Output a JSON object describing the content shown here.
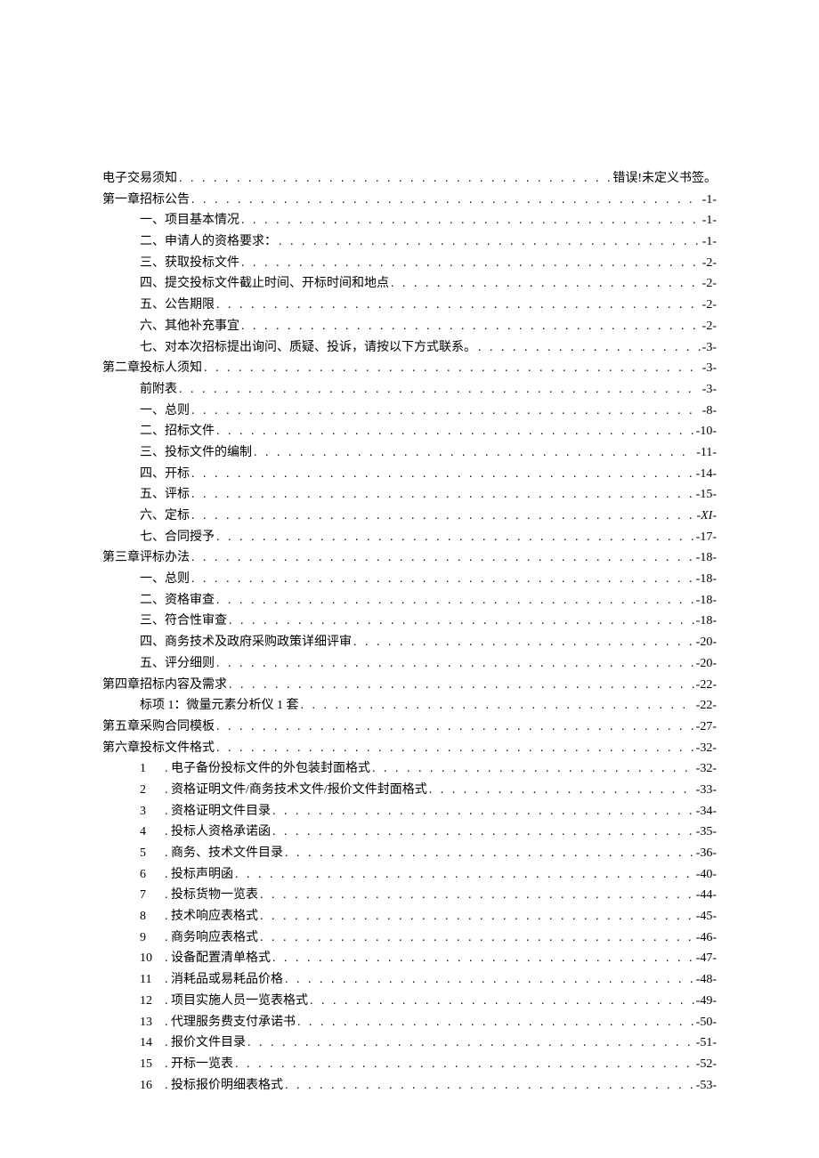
{
  "toc": [
    {
      "level": 0,
      "title": "电子交易须知",
      "page": "错误!未定义书签。"
    },
    {
      "level": 0,
      "title": "第一章招标公告",
      "page": "-1-"
    },
    {
      "level": 1,
      "title": "一、项目基本情况",
      "page": "-1-"
    },
    {
      "level": 1,
      "title": "二、申请人的资格要求：",
      "page": "-1-"
    },
    {
      "level": 1,
      "title": "三、获取投标文件",
      "page": "-2-"
    },
    {
      "level": 1,
      "title": "四、提交投标文件截止时间、开标时间和地点",
      "page": "-2-"
    },
    {
      "level": 1,
      "title": "五、公告期限",
      "page": "-2-"
    },
    {
      "level": 1,
      "title": "六、其他补充事宜",
      "page": "-2-"
    },
    {
      "level": 1,
      "title": "七、对本次招标提出询问、质疑、投诉，请按以下方式联系。",
      "page": "-3-"
    },
    {
      "level": 0,
      "title": "第二章投标人须知",
      "page": "-3-"
    },
    {
      "level": 1,
      "title": "前附表",
      "page": "-3-"
    },
    {
      "level": 1,
      "title": "一、总则",
      "page": "-8-"
    },
    {
      "level": 1,
      "title": "二、招标文件",
      "page": "-10-"
    },
    {
      "level": 1,
      "title": "三、投标文件的编制",
      "page": "-11-"
    },
    {
      "level": 1,
      "title": "四、开标",
      "page": "-14-"
    },
    {
      "level": 1,
      "title": "五、评标",
      "page": "-15-"
    },
    {
      "level": 1,
      "title": "六、定标",
      "page": "-XI-",
      "italic": true
    },
    {
      "level": 1,
      "title": "七、合同授予",
      "page": "-17-"
    },
    {
      "level": 0,
      "title": "第三章评标办法",
      "page": "-18-"
    },
    {
      "level": 1,
      "title": "一、总则",
      "page": "-18-"
    },
    {
      "level": 1,
      "title": "二、资格审查",
      "page": "-18-"
    },
    {
      "level": 1,
      "title": "三、符合性审查",
      "page": "-18-"
    },
    {
      "level": 1,
      "title": "四、商务技术及政府采购政策详细评审",
      "page": "-20-"
    },
    {
      "level": 1,
      "title": "五、评分细则",
      "page": "-20-"
    },
    {
      "level": 0,
      "title": "第四章招标内容及需求",
      "page": "-22-"
    },
    {
      "level": 1,
      "title": "标项 1：微量元素分析仪 1 套",
      "page": "-22-"
    },
    {
      "level": 0,
      "title": "第五章采购合同模板",
      "page": "-27-"
    },
    {
      "level": 0,
      "title": "第六章投标文件格式",
      "page": "-32-"
    },
    {
      "level": 1,
      "num": "1",
      "title": ". 电子备份投标文件的外包装封面格式",
      "page": "-32-"
    },
    {
      "level": 1,
      "num": "2",
      "title": ". 资格证明文件/商务技术文件/报价文件封面格式",
      "page": "-33-"
    },
    {
      "level": 1,
      "num": "3",
      "title": ". 资格证明文件目录",
      "page": "-34-"
    },
    {
      "level": 1,
      "num": "4",
      "title": ". 投标人资格承诺函",
      "page": "-35-"
    },
    {
      "level": 1,
      "num": "5",
      "title": ". 商务、技术文件目录",
      "page": "-36-"
    },
    {
      "level": 1,
      "num": "6",
      "title": ". 投标声明函",
      "page": "-40-"
    },
    {
      "level": 1,
      "num": "7",
      "title": ". 投标货物一览表",
      "page": "-44-"
    },
    {
      "level": 1,
      "num": "8",
      "title": ". 技术响应表格式",
      "page": "-45-"
    },
    {
      "level": 1,
      "num": "9",
      "title": ". 商务响应表格式",
      "page": "-46-"
    },
    {
      "level": 1,
      "num": "10",
      "title": ". 设备配置清单格式",
      "page": "-47-"
    },
    {
      "level": 1,
      "num": "11",
      "title": ". 消耗品或易耗品价格",
      "page": "-48-"
    },
    {
      "level": 1,
      "num": "12",
      "title": ". 项目实施人员一览表格式",
      "page": "-49-"
    },
    {
      "level": 1,
      "num": "13",
      "title": ". 代理服务费支付承诺书",
      "page": "-50-"
    },
    {
      "level": 1,
      "num": "14",
      "title": ". 报价文件目录",
      "page": "-51-"
    },
    {
      "level": 1,
      "num": "15",
      "title": ". 开标一览表",
      "page": "-52-"
    },
    {
      "level": 1,
      "num": "16",
      "title": ". 投标报价明细表格式",
      "page": "-53-"
    }
  ]
}
